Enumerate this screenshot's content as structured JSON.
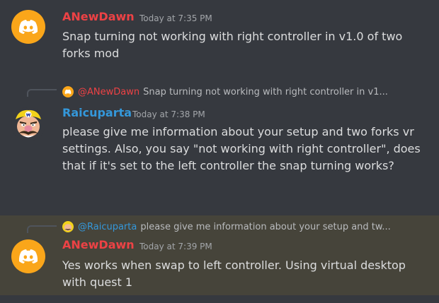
{
  "colors": {
    "background": "#36393f",
    "highlight_background": "#46443a",
    "username_anewdawn": "#ed4245",
    "username_raicuparta": "#3498db",
    "message_text": "#dcddde",
    "timestamp": "#a3a6aa",
    "discord_avatar": "#faa61a"
  },
  "messages": [
    {
      "author": "ANewDawn",
      "timestamp": "Today at 7:35 PM",
      "avatar_icon": "discord-logo-icon",
      "text": "Snap turning not working with right controller in v1.0 of two forks mod"
    },
    {
      "reply": {
        "mention": "@ANewDawn",
        "text": "Snap turning not working with right controller in v1..."
      },
      "author": "Raicuparta",
      "timestamp": "Today at 7:38 PM",
      "avatar_icon": "wario-face-icon",
      "text": "please give me information about your setup and two forks vr settings. Also, you say \"not working with right controller\", does that if it's set to the left controller the snap turning works?"
    },
    {
      "reply": {
        "mention": "@Raicuparta",
        "text": "please give me information about your setup and tw..."
      },
      "author": "ANewDawn",
      "timestamp": "Today at 7:39 PM",
      "avatar_icon": "discord-logo-icon",
      "highlighted": true,
      "text": "Yes works when swap to left controller. Using virtual desktop with quest 1"
    }
  ]
}
